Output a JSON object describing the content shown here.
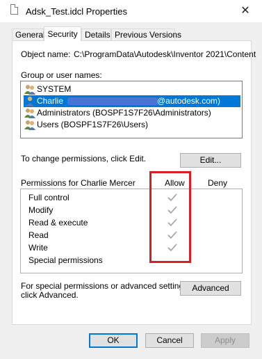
{
  "window": {
    "title": "Adsk_Test.idcl Properties",
    "close_label": "✕"
  },
  "tabs": [
    {
      "label": "General"
    },
    {
      "label": "Security"
    },
    {
      "label": "Details"
    },
    {
      "label": "Previous Versions"
    }
  ],
  "security": {
    "object_name_label": "Object name:",
    "object_name_value": "C:\\ProgramData\\Autodesk\\Inventor 2021\\Content",
    "group_label": "Group or user names:",
    "groups": [
      {
        "name": "SYSTEM",
        "icon": "group-icon"
      },
      {
        "name": "Charlie",
        "suffix": "@autodesk.com)",
        "icon": "user-icon",
        "selected": true
      },
      {
        "name": "Administrators (BOSPF1S7F26\\Administrators)",
        "icon": "group-icon"
      },
      {
        "name": "Users (BOSPF1S7F26\\Users)",
        "icon": "group-icon"
      }
    ],
    "change_permissions_text": "To change permissions, click Edit.",
    "edit_button": "Edit...",
    "permissions_for_label": "Permissions for Charlie Mercer",
    "allow_header": "Allow",
    "deny_header": "Deny",
    "permissions": [
      {
        "name": "Full control",
        "allow": true,
        "deny": false
      },
      {
        "name": "Modify",
        "allow": true,
        "deny": false
      },
      {
        "name": "Read & execute",
        "allow": true,
        "deny": false
      },
      {
        "name": "Read",
        "allow": true,
        "deny": false
      },
      {
        "name": "Write",
        "allow": true,
        "deny": false
      },
      {
        "name": "Special permissions",
        "allow": false,
        "deny": false
      }
    ],
    "special_text_line1": "For special permissions or advanced settings,",
    "special_text_line2": "click Advanced.",
    "advanced_button": "Advanced"
  },
  "footer": {
    "ok_button": "OK",
    "cancel_button": "Cancel",
    "apply_button": "Apply"
  },
  "colors": {
    "selection": "#0078d7",
    "highlight_box": "#d81f26",
    "check_gray": "#a0a0a0"
  }
}
